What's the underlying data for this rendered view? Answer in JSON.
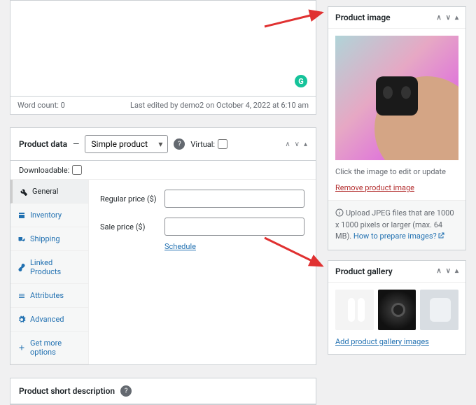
{
  "editor": {
    "word_count_label": "Word count: 0",
    "last_edited": "Last edited by demo2 on October 4, 2022 at 6:10 am"
  },
  "product_data": {
    "title": "Product data",
    "dash": "—",
    "type_selected": "Simple product",
    "virtual_label": "Virtual:",
    "downloadable_label": "Downloadable:",
    "tabs": {
      "general": "General",
      "inventory": "Inventory",
      "shipping": "Shipping",
      "linked": "Linked Products",
      "attributes": "Attributes",
      "advanced": "Advanced",
      "getmore": "Get more options"
    },
    "fields": {
      "regular_price": "Regular price ($)",
      "sale_price": "Sale price ($)",
      "schedule": "Schedule"
    }
  },
  "short_desc": {
    "title": "Product short description"
  },
  "product_image": {
    "title": "Product image",
    "hint": "Click the image to edit or update",
    "remove": "Remove product image",
    "info_prefix": "Upload JPEG files that are 1000 x 1000 pixels or larger (max. 64 MB). ",
    "info_link": "How to prepare images?"
  },
  "product_gallery": {
    "title": "Product gallery",
    "add": "Add product gallery images"
  }
}
